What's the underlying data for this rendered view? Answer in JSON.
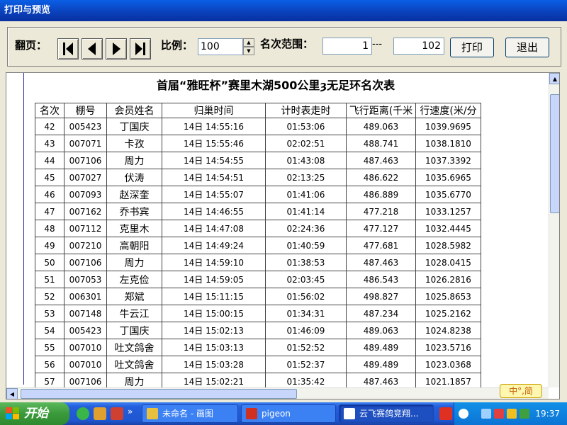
{
  "window": {
    "title": "打印与预览"
  },
  "toolbar": {
    "page_label": "翻页：",
    "scale_label": "比例：",
    "scale_value": "100",
    "range_label": "名次范围：",
    "range_from": "1",
    "range_sep": "---",
    "range_to": "102",
    "print_label": "打印",
    "exit_label": "退出"
  },
  "report": {
    "title": "首届“雅旺杯”赛里木湖500公里ȝ无足环名次表",
    "columns": [
      "名次",
      "棚号",
      "会员姓名",
      "归巢时间",
      "计时表走时",
      "飞行距离(千米",
      "行速度(米/分"
    ],
    "rows": [
      [
        "42",
        "005423",
        "丁国庆",
        "14日 14:55:16",
        "01:53:06",
        "489.063",
        "1039.9695"
      ],
      [
        "43",
        "007071",
        "卡孜",
        "14日 15:55:46",
        "02:02:51",
        "488.741",
        "1038.1810"
      ],
      [
        "44",
        "007106",
        "周力",
        "14日 14:54:55",
        "01:43:08",
        "487.463",
        "1037.3392"
      ],
      [
        "45",
        "007027",
        "伏涛",
        "14日 14:54:51",
        "02:13:25",
        "486.622",
        "1035.6965"
      ],
      [
        "46",
        "007093",
        "赵深奎",
        "14日 14:55:07",
        "01:41:06",
        "486.889",
        "1035.6770"
      ],
      [
        "47",
        "007162",
        "乔书宾",
        "14日 14:46:55",
        "01:41:14",
        "477.218",
        "1033.1257"
      ],
      [
        "48",
        "007112",
        "克里木",
        "14日 14:47:08",
        "02:24:36",
        "477.127",
        "1032.4445"
      ],
      [
        "49",
        "007210",
        "高朝阳",
        "14日 14:49:24",
        "01:40:59",
        "477.681",
        "1028.5982"
      ],
      [
        "50",
        "007106",
        "周力",
        "14日 14:59:10",
        "01:38:53",
        "487.463",
        "1028.0415"
      ],
      [
        "51",
        "007053",
        "左克俭",
        "14日 14:59:05",
        "02:03:45",
        "486.543",
        "1026.2816"
      ],
      [
        "52",
        "006301",
        "郑斌",
        "14日 15:11:15",
        "01:56:02",
        "498.827",
        "1025.8653"
      ],
      [
        "53",
        "007148",
        "牛云江",
        "14日 15:00:15",
        "01:34:31",
        "487.234",
        "1025.2162"
      ],
      [
        "54",
        "005423",
        "丁国庆",
        "14日 15:02:13",
        "01:46:09",
        "489.063",
        "1024.8238"
      ],
      [
        "55",
        "007010",
        "吐文鸽舍",
        "14日 15:03:13",
        "01:52:52",
        "489.489",
        "1023.5716"
      ],
      [
        "56",
        "007010",
        "吐文鸽舍",
        "14日 15:03:28",
        "01:52:37",
        "489.489",
        "1023.0368"
      ],
      [
        "57",
        "007106",
        "周力",
        "14日 15:02:21",
        "01:35:42",
        "487.463",
        "1021.1857"
      ]
    ]
  },
  "ime": {
    "label": "中°,简"
  },
  "taskbar": {
    "start_label": "开始",
    "tasks": [
      "未命名 - 画图",
      "pigeon",
      "云飞赛鸽竞翔..."
    ],
    "clock": "19:37",
    "expander": "»"
  },
  "colors": {
    "title_blue": "#0a3fb8",
    "taskbar_blue": "#245edb",
    "start_green": "#3a9a3a"
  }
}
